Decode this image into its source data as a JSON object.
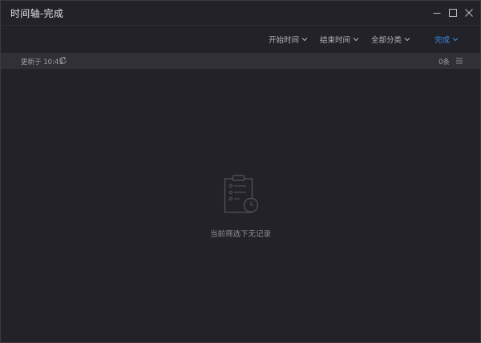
{
  "window": {
    "title": "时间轴-完成"
  },
  "filters": [
    {
      "label": "开始时间"
    },
    {
      "label": "结束时间"
    },
    {
      "label": "全部分类"
    },
    {
      "label": "完成"
    }
  ],
  "status": {
    "updated_text": "更新于 10:43",
    "count_text": "0条"
  },
  "empty_state": {
    "message": "当前筛选下无记录",
    "icon": "clipboard-clock-icon"
  },
  "colors": {
    "background": "#222228",
    "statusbar": "#303036",
    "accent": "#3d8de8"
  }
}
